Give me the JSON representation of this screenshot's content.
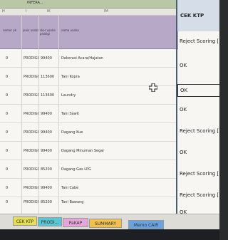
{
  "sheet": {
    "top_bar_text": "INFERA...",
    "column_letters": [
      "H",
      "I",
      "IK",
      "IM"
    ],
    "headers": [
      "nomor pk",
      "jenis usaha",
      "skor usaha prodigi",
      "nama usaha"
    ],
    "rows": [
      {
        "program": "PRODIGI",
        "score": "99400",
        "business": "Dekorasi Acara/Hajatan",
        "status": "Reject Scoring ["
      },
      {
        "program": "PRODIGI",
        "score": "113600",
        "business": "Tani Kopra",
        "status": "OK"
      },
      {
        "program": "PRODIGI",
        "score": "113600",
        "business": "Laundry",
        "status": "OK"
      },
      {
        "program": "PRODIGI",
        "score": "99400",
        "business": "Tani Sawit",
        "status": "OK"
      },
      {
        "program": "PRODIGI",
        "score": "99400",
        "business": "Dagang Kue",
        "status": "Reject Scoring ["
      },
      {
        "program": "PRODIGI",
        "score": "99400",
        "business": "Dagang Minuman Segar",
        "status": "OK"
      },
      {
        "program": "PRODIGI",
        "score": "85200",
        "business": "Dagang Gas LPG",
        "status": "Reject Scoring ["
      },
      {
        "program": "PRODIGI",
        "score": "99400",
        "business": "Tani Cabe",
        "status": "Reject Scoring ["
      },
      {
        "program": "PRODIGI",
        "score": "85200",
        "business": "Tani Bawang",
        "status": "OK"
      }
    ],
    "ktp_header": "CEK KTP"
  },
  "tabs": [
    {
      "label": "CEK KTP",
      "color": "#e7de53"
    },
    {
      "label": "PRODI...",
      "color": "#58c6d4"
    },
    {
      "label": "PaKAP",
      "color": "#e6a5d9"
    },
    {
      "label": "SUMMARY",
      "color": "#f2c04d"
    },
    {
      "label": "Memo CAIR",
      "color": "#6aa2e0"
    }
  ],
  "icons": {
    "cursor": "plus-cursor-icon"
  }
}
